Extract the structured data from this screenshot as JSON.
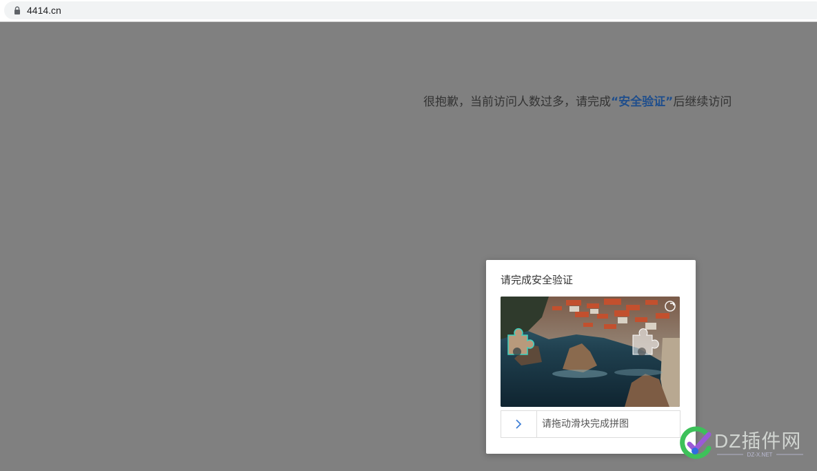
{
  "browser": {
    "url": "4414.cn"
  },
  "notice": {
    "prefix": "很抱歉，当前访问人数过多，请完成",
    "highlight": "“安全验证”",
    "suffix": "后继续访问"
  },
  "captcha": {
    "title": "请完成安全验证",
    "slider_hint": "请拖动滑块完成拼图",
    "image_description_icons": {
      "refresh": "refresh-icon",
      "handle": "chevron-right-icon"
    },
    "slider_progress": 0
  },
  "watermark": {
    "brand": "DZ插件网",
    "sub": "DZ-X.NET"
  },
  "colors": {
    "overlay": "#808080",
    "highlight": "#1f4e8c",
    "handle_arrow": "#3f7fd6"
  }
}
